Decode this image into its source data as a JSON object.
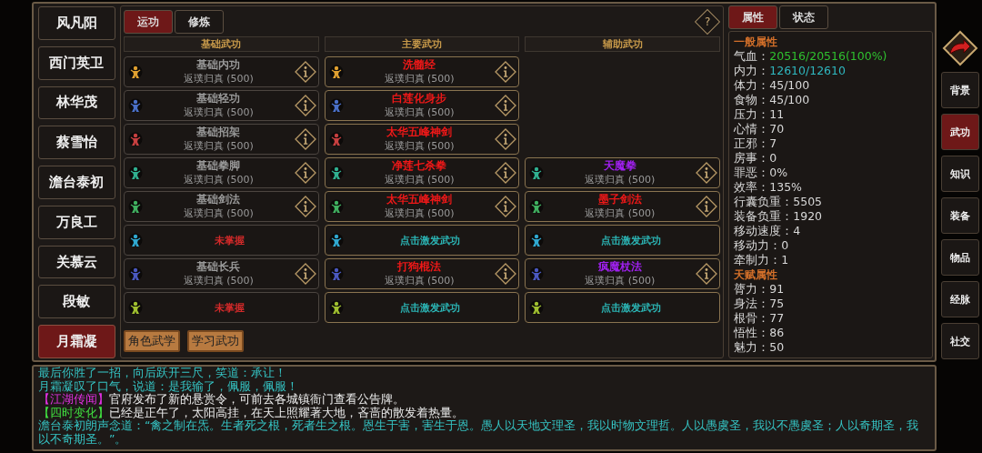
{
  "characters": [
    {
      "name": "风凡阳",
      "selected": false
    },
    {
      "name": "西门英卫",
      "selected": false
    },
    {
      "name": "林华茂",
      "selected": false
    },
    {
      "name": "蔡雪怡",
      "selected": false
    },
    {
      "name": "澹台泰初",
      "selected": false
    },
    {
      "name": "万良工",
      "selected": false
    },
    {
      "name": "关慕云",
      "selected": false
    },
    {
      "name": "段敏",
      "selected": false
    },
    {
      "name": "月霜凝",
      "selected": true
    }
  ],
  "martial": {
    "tabs": [
      {
        "label": "运功",
        "selected": true
      },
      {
        "label": "修炼",
        "selected": false
      }
    ],
    "help_label": "?",
    "columns": [
      {
        "title": "基础武功",
        "slots": [
          {
            "kind": "skill",
            "name": "基础内功",
            "color": "#9a9a9a",
            "level": "返璞归真 (500)"
          },
          {
            "kind": "skill",
            "name": "基础轻功",
            "color": "#9a9a9a",
            "level": "返璞归真 (500)"
          },
          {
            "kind": "skill",
            "name": "基础招架",
            "color": "#9a9a9a",
            "level": "返璞归真 (500)"
          },
          {
            "kind": "skill",
            "name": "基础拳脚",
            "color": "#9a9a9a",
            "level": "返璞归真 (500)"
          },
          {
            "kind": "skill",
            "name": "基础剑法",
            "color": "#9a9a9a",
            "level": "返璞归真 (500)"
          },
          {
            "kind": "empty",
            "text": "未掌握",
            "color": "#d42a2a"
          },
          {
            "kind": "skill",
            "name": "基础长兵",
            "color": "#9a9a9a",
            "level": "返璞归真 (500)"
          },
          {
            "kind": "empty",
            "text": "未掌握",
            "color": "#d42a2a"
          }
        ]
      },
      {
        "title": "主要武功",
        "slots": [
          {
            "kind": "skill",
            "name": "洗髓经",
            "color": "#f01818",
            "level": "返璞归真 (500)"
          },
          {
            "kind": "skill",
            "name": "白莲化身步",
            "color": "#f01818",
            "level": "返璞归真 (500)"
          },
          {
            "kind": "skill",
            "name": "太华五峰神剑",
            "color": "#f01818",
            "level": "返璞归真 (500)"
          },
          {
            "kind": "skill",
            "name": "净莲七杀拳",
            "color": "#f01818",
            "level": "返璞归真 (500)"
          },
          {
            "kind": "skill",
            "name": "太华五峰神剑",
            "color": "#f01818",
            "level": "返璞归真 (500)"
          },
          {
            "kind": "empty",
            "text": "点击激发武功",
            "color": "#2bb3b3"
          },
          {
            "kind": "skill",
            "name": "打狗棍法",
            "color": "#f01818",
            "level": "返璞归真 (500)"
          },
          {
            "kind": "empty",
            "text": "点击激发武功",
            "color": "#2bb3b3"
          }
        ]
      },
      {
        "title": "辅助武功",
        "slots": [
          {
            "kind": "none"
          },
          {
            "kind": "none"
          },
          {
            "kind": "none"
          },
          {
            "kind": "skill",
            "name": "天魔拳",
            "color": "#a020f0",
            "level": "返璞归真 (500)"
          },
          {
            "kind": "skill",
            "name": "墨子剑法",
            "color": "#f01818",
            "level": "返璞归真 (500)"
          },
          {
            "kind": "empty",
            "text": "点击激发武功",
            "color": "#2bb3b3"
          },
          {
            "kind": "skill",
            "name": "疯魔杖法",
            "color": "#a020f0",
            "level": "返璞归真 (500)"
          },
          {
            "kind": "empty",
            "text": "点击激发武功",
            "color": "#2bb3b3"
          }
        ]
      }
    ],
    "buttons": [
      "角色武学",
      "学习武功"
    ]
  },
  "attributes": {
    "tabs": [
      {
        "label": "属性",
        "selected": true
      },
      {
        "label": "状态",
        "selected": false
      }
    ],
    "sections": [
      {
        "title": "一般属性",
        "items": [
          {
            "label": "气血：",
            "value": "20516/20516(100%)",
            "color": "#2fc02f"
          },
          {
            "label": "内力：",
            "value": "12610/12610",
            "color": "#2fb8c0"
          },
          {
            "label": "体力：",
            "value": "45/100",
            "color": "#d8d8d8"
          },
          {
            "label": "食物：",
            "value": "45/100",
            "color": "#d8d8d8"
          },
          {
            "label": "压力：",
            "value": "11",
            "color": "#d8d8d8"
          },
          {
            "label": "心情：",
            "value": "70",
            "color": "#d8d8d8"
          },
          {
            "label": "正邪：",
            "value": "7",
            "color": "#d8d8d8"
          },
          {
            "label": "房事：",
            "value": "0",
            "color": "#d8d8d8"
          },
          {
            "label": "罪恶：",
            "value": "0%",
            "color": "#d8d8d8"
          },
          {
            "label": "效率：",
            "value": "135%",
            "color": "#d8d8d8"
          },
          {
            "label": "行囊负重：",
            "value": "5505",
            "color": "#d8d8d8"
          },
          {
            "label": "装备负重：",
            "value": "1920",
            "color": "#d8d8d8"
          },
          {
            "label": "移动速度：",
            "value": "4",
            "color": "#d8d8d8"
          },
          {
            "label": "移动力：",
            "value": "0",
            "color": "#d8d8d8"
          },
          {
            "label": "牵制力：",
            "value": "1",
            "color": "#d8d8d8"
          }
        ]
      },
      {
        "title": "天赋属性",
        "items": [
          {
            "label": "膂力：",
            "value": "91",
            "color": "#d8d8d8"
          },
          {
            "label": "身法：",
            "value": "75",
            "color": "#d8d8d8"
          },
          {
            "label": "根骨：",
            "value": "77",
            "color": "#d8d8d8"
          },
          {
            "label": "悟性：",
            "value": "86",
            "color": "#d8d8d8"
          },
          {
            "label": "魅力：",
            "value": "50",
            "color": "#d8d8d8"
          }
        ]
      }
    ]
  },
  "nav": [
    {
      "label": "背景",
      "selected": false
    },
    {
      "label": "武功",
      "selected": true
    },
    {
      "label": "知识",
      "selected": false
    },
    {
      "label": "装备",
      "selected": false
    },
    {
      "label": "物品",
      "selected": false
    },
    {
      "label": "经脉",
      "selected": false
    },
    {
      "label": "社交",
      "selected": false
    }
  ],
  "log": [
    {
      "text": "最后你胜了一招，向后跃开三尺，笑道：承让！",
      "color": "#35c4c4"
    },
    {
      "text": "月霜凝叹了口气，说道：是我输了，佩服，佩服！",
      "color": "#35c4c4"
    },
    {
      "tag": {
        "text": "【江湖传闻】",
        "color": "#e030e0"
      },
      "text": "官府发布了新的悬赏令，可前去各城镇衙门查看公告牌。",
      "color": "#ececec"
    },
    {
      "tag": {
        "text": "【四时变化】",
        "color": "#40e040"
      },
      "text": "已经是正午了，太阳高挂，在天上照耀著大地，吝啬的散发着热量。",
      "color": "#ececec"
    },
    {
      "text": "澹台泰初朗声念道：“禽之制在炁。生者死之根，死者生之根。恩生于害，害生于恩。愚人以天地文理圣，我以时物文理哲。人以愚虞圣，我以不愚虞圣；人以奇期圣，我以不奇期圣。”。",
      "color": "#35c4c4"
    }
  ]
}
